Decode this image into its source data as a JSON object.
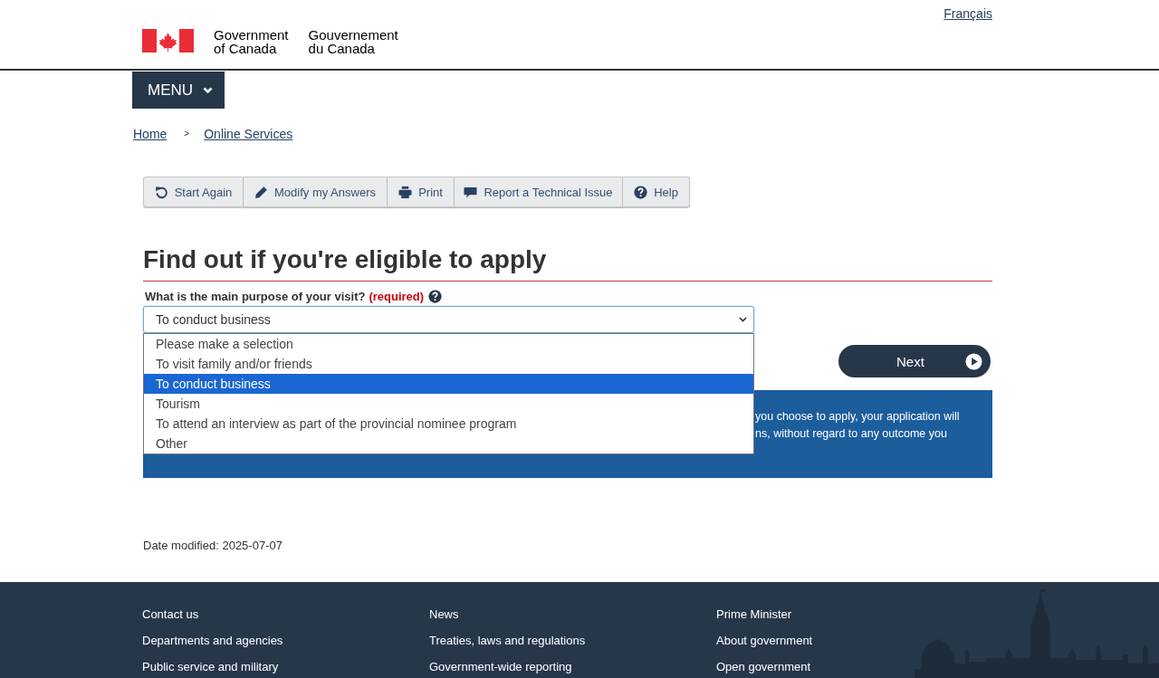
{
  "header": {
    "language_link": "Français",
    "signature_en": [
      "Government",
      "of Canada"
    ],
    "signature_fr": [
      "Gouvernement",
      "du Canada"
    ]
  },
  "menu": {
    "label": "MENU",
    "expanded": false
  },
  "breadcrumb": {
    "items": [
      "Home",
      "Online Services"
    ],
    "separator": ">"
  },
  "toolbar": [
    "Start Again",
    "Modify my Answers",
    "Print",
    "Report a Technical Issue",
    "Help"
  ],
  "title": "Find out if you're eligible to apply",
  "question": {
    "label": "What is the main purpose of your visit?",
    "required": "(required)",
    "value": "To conduct business",
    "expanded": true,
    "options": [
      {
        "label": "Please make a selection",
        "selected": false
      },
      {
        "label": "To visit family and/or friends",
        "selected": false
      },
      {
        "label": "To conduct business",
        "selected": true
      },
      {
        "label": "Tourism",
        "selected": false
      },
      {
        "label": "To attend an interview as part of the provincial nominee program",
        "selected": false
      },
      {
        "label": "Other",
        "selected": false
      }
    ]
  },
  "next_button": "Next",
  "notice": {
    "lines": [
      "you choose to apply, your application will",
      "ns, without regard to any outcome you"
    ]
  },
  "date_modified": "Date modified: 2025-07-07",
  "footer": {
    "columns": [
      [
        "Contact us",
        "Departments and agencies",
        "Public service and military"
      ],
      [
        "News",
        "Treaties, laws and regulations",
        "Government-wide reporting"
      ],
      [
        "Prime Minister",
        "About government",
        "Open government"
      ]
    ]
  }
}
